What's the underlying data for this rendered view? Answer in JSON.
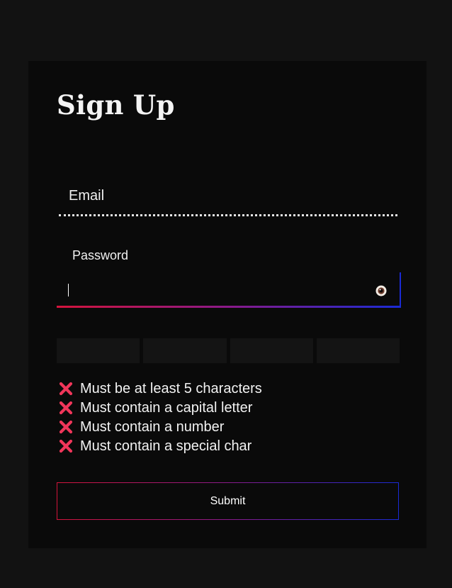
{
  "form": {
    "title": "Sign Up",
    "email": {
      "label": "Email",
      "value": ""
    },
    "password": {
      "label": "Password",
      "value": "",
      "toggle_icon": "eye-icon"
    },
    "strength_meter": {
      "segments": 4,
      "filled": 0
    },
    "rules": [
      {
        "text": "Must be at least 5 characters",
        "met": false,
        "icon": "cross-icon"
      },
      {
        "text": "Must contain a capital letter",
        "met": false,
        "icon": "cross-icon"
      },
      {
        "text": "Must contain a number",
        "met": false,
        "icon": "cross-icon"
      },
      {
        "text": "Must contain a special char",
        "met": false,
        "icon": "cross-icon"
      }
    ],
    "submit_label": "Submit"
  },
  "colors": {
    "page_background": "#121212",
    "card_background": "#0a0a0a",
    "accent_red": "#d4143c",
    "accent_blue": "#1a2bd6",
    "rule_fail": "#f0365a"
  }
}
